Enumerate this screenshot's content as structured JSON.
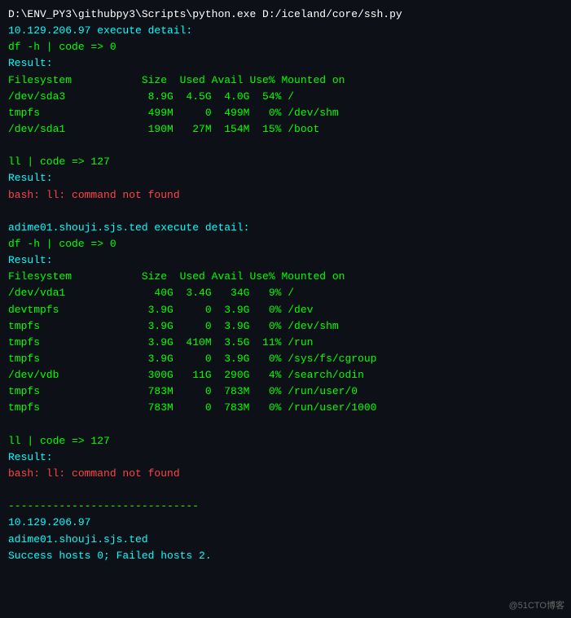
{
  "terminal": {
    "header": "D:\\ENV_PY3\\githubpy3\\Scripts\\python.exe D:/iceland/core/ssh.py",
    "block1": {
      "title": "10.129.206.97 execute detail:",
      "cmd1": "df -h | code => 0",
      "result1": "Result:",
      "table1_header": "Filesystem           Size  Used Avail Use% Mounted on",
      "table1_row1": "/dev/sda3             8.9G  4.5G  4.0G  54% /",
      "table1_row2": "tmpfs                 499M     0  499M   0% /dev/shm",
      "table1_row3": "/dev/sda1             190M   27M  154M  15% /boot",
      "cmd2": "ll | code => 127",
      "result2": "Result:",
      "error1": "bash: ll: command not found"
    },
    "block2": {
      "title": "adime01.shouji.sjs.ted execute detail:",
      "cmd1": "df -h | code => 0",
      "result1": "Result:",
      "table2_header": "Filesystem           Size  Used Avail Use% Mounted on",
      "table2_row1": "/dev/vda1              40G  3.4G   34G   9% /",
      "table2_row2": "devtmpfs              3.9G     0  3.9G   0% /dev",
      "table2_row3": "tmpfs                 3.9G     0  3.9G   0% /dev/shm",
      "table2_row4": "tmpfs                 3.9G  410M  3.5G  11% /run",
      "table2_row5": "tmpfs                 3.9G     0  3.9G   0% /sys/fs/cgroup",
      "table2_row6": "/dev/vdb              300G   11G  290G   4% /search/odin",
      "table2_row7": "tmpfs                 783M     0  783M   0% /run/user/0",
      "table2_row8": "tmpfs                 783M     0  783M   0% /run/user/1000",
      "cmd2": "ll | code => 127",
      "result2": "Result:",
      "error1": "bash: ll: command not found"
    },
    "divider": "------------------------------",
    "host1": "10.129.206.97",
    "host2": "adime01.shouji.sjs.ted",
    "summary": "Success hosts 0; Failed hosts 2.",
    "watermark": "@51CTO博客"
  }
}
